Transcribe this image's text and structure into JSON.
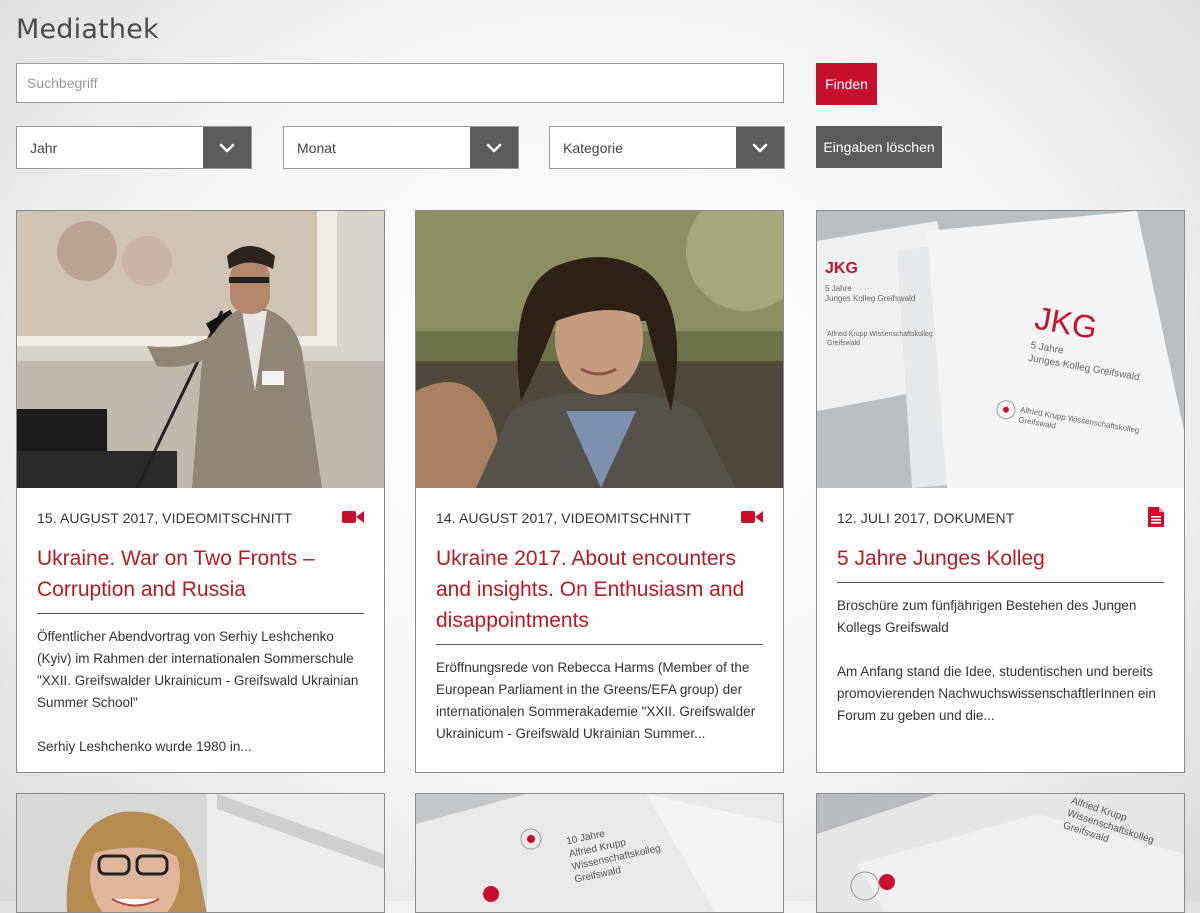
{
  "page": {
    "title": "Mediathek"
  },
  "search": {
    "placeholder": "Suchbegriff",
    "value": "",
    "submit_label": "Finden"
  },
  "filters": [
    {
      "label": "Jahr"
    },
    {
      "label": "Monat"
    },
    {
      "label": "Kategorie"
    }
  ],
  "clear_label": "Eingaben löschen",
  "colors": {
    "accent": "#c8102e",
    "title": "#b51a2b",
    "control_dark": "#5b5b5b"
  },
  "cards": [
    {
      "meta": "15. August 2017, Videomitschnitt",
      "icon": "video-camera-icon",
      "title": "Ukraine. War on Two Fronts – Corruption and Russia",
      "paragraphs": [
        "Öffentlicher Abendvortrag von Serhiy Leshchenko (Kyiv) im Rahmen der internationalen Sommerschule \"XXII. Greifswalder Ukrainicum - Greifswald Ukrainian Summer School\"",
        "Serhiy Leshchenko wurde 1980 in..."
      ]
    },
    {
      "meta": "14. August 2017, Videomitschnitt",
      "icon": "video-camera-icon",
      "title": "Ukraine 2017. About encounters and insights. On Enthusiasm and disappointments",
      "paragraphs": [
        "Eröffnungsrede von Rebecca Harms (Member of the European Parliament in the Greens/EFA group) der internationalen Sommerakademie \"XXII. Greifswalder Ukrainicum - Greifswald Ukrainian Summer..."
      ]
    },
    {
      "meta": "12. Juli 2017, Dokument",
      "icon": "document-icon",
      "title": "5 Jahre Junges Kolleg",
      "paragraphs": [
        "Broschüre zum fünfjährigen Bestehen des Jungen Kollegs Greifswald",
        "Am Anfang stand die Idee, studentischen und bereits promovierenden NachwuchswissenschaftlerInnen ein Forum zu geben und die..."
      ]
    }
  ],
  "images": {
    "jkg_logo": "JKG",
    "jkg_line1": "5 Jahre",
    "jkg_line2": "Junges Kolleg Greifswald",
    "jkg_cover_logo": "JKG",
    "jkg_cover_line1": "5 Jahre",
    "jkg_cover_line2": "Junges Kolleg Greifswald",
    "jkg_org1": "Alfried Krupp Wissenschaftskolleg",
    "jkg_org2": "Greifswald",
    "jkg_side1": "Alfried Krupp Wissenschaftskolleg",
    "jkg_side2": "Greifswald",
    "b2_line1": "10 Jahre",
    "b2_line2": "Alfried Krupp",
    "b2_line3": "Wissenschaftskolleg",
    "b2_line4": "Greifswald",
    "b3_line1": "Alfried Krupp",
    "b3_line2": "Wissenschaftskolleg",
    "b3_line3": "Greifswald"
  }
}
